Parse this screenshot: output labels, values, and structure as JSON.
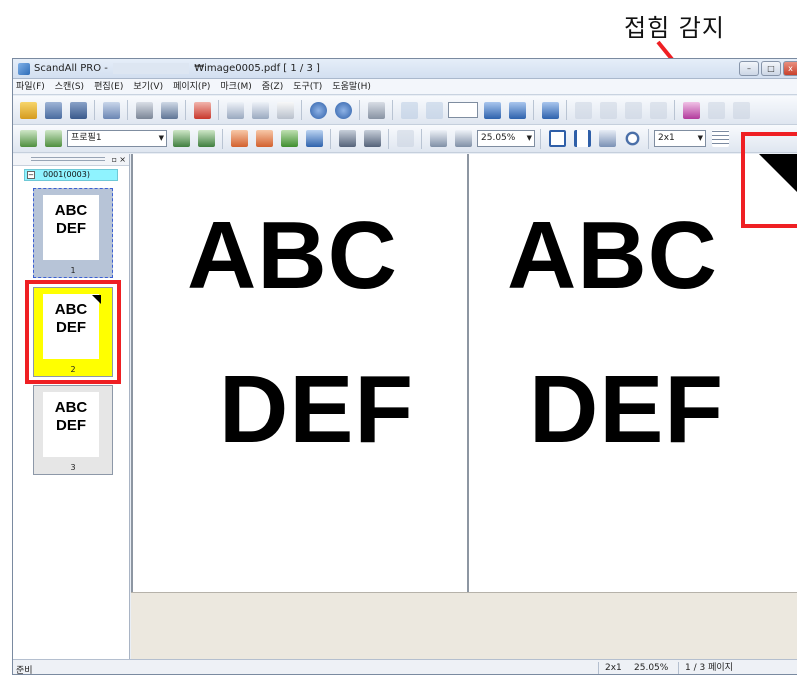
{
  "callout": {
    "label": "접힘 감지"
  },
  "window": {
    "title_prefix": "ScandAll PRO -",
    "title_suffix": "₩image0005.pdf  [ 1 / 3 ]",
    "buttons": {
      "minimize": "–",
      "maximize": "□",
      "close": "x"
    }
  },
  "menu": [
    "파일(F)",
    "스캔(S)",
    "편집(E)",
    "보기(V)",
    "페이지(P)",
    "마크(M)",
    "줌(Z)",
    "도구(T)",
    "도움말(H)"
  ],
  "toolbar2": {
    "profile_value": "프로필1",
    "zoom_value": "25.05%",
    "layout_value": "2x1"
  },
  "thumbnails": {
    "group_label": "0001(0003)",
    "pages": [
      {
        "line1": "ABC",
        "line2": "DEF",
        "number": "1"
      },
      {
        "line1": "ABC",
        "line2": "DEF",
        "number": "2"
      },
      {
        "line1": "ABC",
        "line2": "DEF",
        "number": "3"
      }
    ]
  },
  "view": {
    "page1": {
      "line1": "ABC",
      "line2": "DEF"
    },
    "page2": {
      "line1": "ABC",
      "line2": "DEF"
    }
  },
  "status": {
    "ready": "준비",
    "layout": "2x1",
    "zoom": "25.05%",
    "page": "1 / 3 페이지"
  },
  "colors": {
    "highlight_red": "#ef1f23",
    "group_cyan": "#8ff3ff",
    "folded_page_yellow": "#ffff00",
    "selected_thumb": "#b7c4d7"
  }
}
